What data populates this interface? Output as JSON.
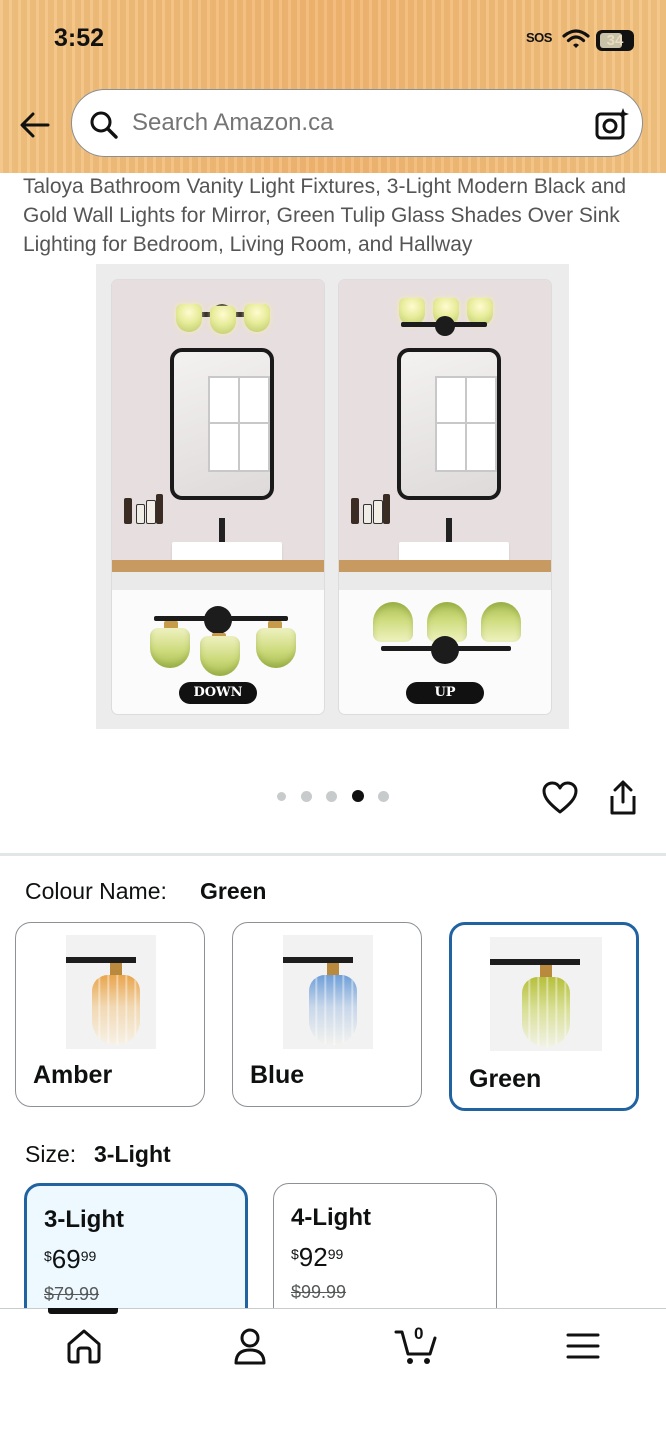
{
  "status_bar": {
    "time": "3:52",
    "sos": "SOS",
    "battery": "34"
  },
  "search": {
    "placeholder": "Search Amazon.ca"
  },
  "product": {
    "title": "Taloya Bathroom Vanity Light Fixtures, 3-Light Modern Black and Gold Wall Lights for Mirror, Green Tulip Glass Shades Over Sink Lighting for Bedroom, Living Room, and Hallway",
    "image_tags": [
      "DOWN",
      "UP"
    ],
    "image_dots": {
      "count": 5,
      "active_index": 3
    }
  },
  "colour": {
    "label": "Colour Name:",
    "selected": "Green",
    "options": [
      {
        "name": "Amber"
      },
      {
        "name": "Blue"
      },
      {
        "name": "Green"
      }
    ]
  },
  "size": {
    "label": "Size:",
    "selected": "3-Light",
    "options": [
      {
        "name": "3-Light",
        "currency": "$",
        "whole": "69",
        "fraction": "99",
        "list_price": "$79.99"
      },
      {
        "name": "4-Light",
        "currency": "$",
        "whole": "92",
        "fraction": "99",
        "list_price": "$99.99"
      }
    ]
  },
  "bottom_nav": {
    "items": [
      "home-icon",
      "account-icon",
      "cart-icon",
      "menu-icon"
    ],
    "cart_count": "0"
  },
  "colors": {
    "header": "#f2b56f",
    "selected_border": "#2162a1",
    "selected_bg": "#edf8ff"
  }
}
